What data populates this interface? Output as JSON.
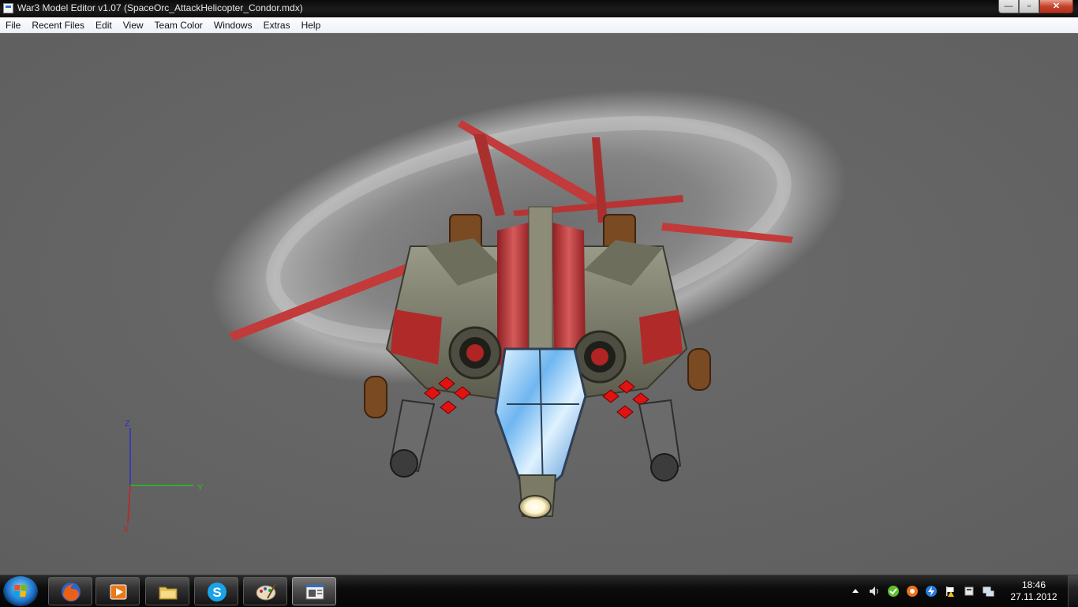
{
  "window": {
    "title": "War3 Model Editor v1.07 (SpaceOrc_AttackHelicopter_Condor.mdx)",
    "buttons": {
      "minimize": "—",
      "maximize": "▫",
      "close": "✕"
    }
  },
  "menu": {
    "items": [
      "File",
      "Recent Files",
      "Edit",
      "View",
      "Team Color",
      "Windows",
      "Extras",
      "Help"
    ]
  },
  "viewport": {
    "background": "#676767",
    "axes": {
      "z_label": "Z",
      "y_label": "Y",
      "x_label": "X",
      "z_color": "#2a33c8",
      "y_color": "#22c422",
      "x_color": "#c82020"
    }
  },
  "taskbar": {
    "pinned": [
      {
        "name": "firefox",
        "icon": "firefox-icon"
      },
      {
        "name": "media-player",
        "icon": "media-player-icon"
      },
      {
        "name": "explorer",
        "icon": "folder-icon"
      },
      {
        "name": "skype",
        "icon": "skype-icon"
      },
      {
        "name": "paint",
        "icon": "paint-palette-icon"
      },
      {
        "name": "war3-model-editor",
        "icon": "model-editor-icon",
        "active": true
      }
    ],
    "tray_icons": [
      "show-hidden-icons-icon",
      "volume-icon",
      "green-app-icon",
      "orange-app-icon",
      "blue-lightning-icon",
      "action-center-flag-icon",
      "device-icon",
      "network-icon"
    ],
    "clock": {
      "time": "18:46",
      "date": "27.11.2012"
    }
  }
}
